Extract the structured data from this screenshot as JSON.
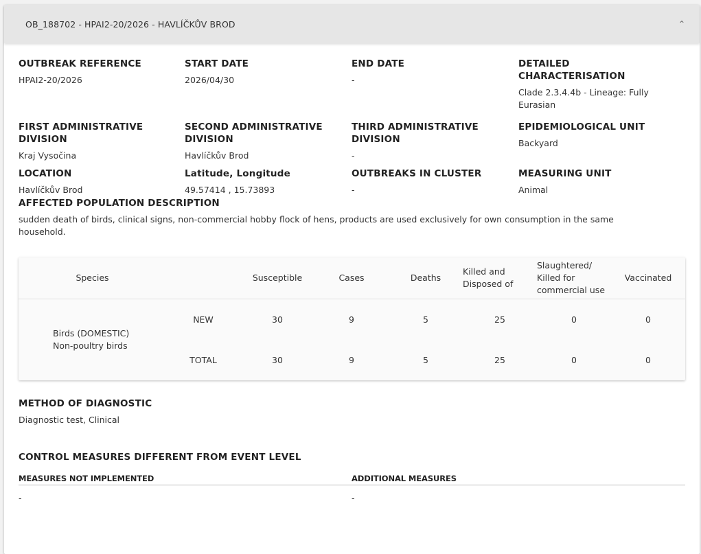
{
  "header": {
    "title": "OB_188702 - HPAI2-20/2026 - HAVLÍČKŮV BROD",
    "collapse_icon": "chevron-up-icon"
  },
  "fields": {
    "outbreak_reference": {
      "label": "OUTBREAK REFERENCE",
      "value": "HPAI2-20/2026"
    },
    "start_date": {
      "label": "START DATE",
      "value": "2026/04/30"
    },
    "end_date": {
      "label": "END DATE",
      "value": "-"
    },
    "detailed_characterisation": {
      "label": "DETAILED CHARACTERISATION",
      "value": "Clade 2.3.4.4b - Lineage: Fully Eurasian"
    },
    "first_admin": {
      "label": "FIRST ADMINISTRATIVE DIVISION",
      "value": "Kraj Vysočina"
    },
    "second_admin": {
      "label": "SECOND ADMINISTRATIVE DIVISION",
      "value": "Havlíčkův Brod"
    },
    "third_admin": {
      "label": "THIRD ADMINISTRATIVE DIVISION",
      "value": "-"
    },
    "epi_unit": {
      "label": "EPIDEMIOLOGICAL UNIT",
      "value": "Backyard"
    },
    "location": {
      "label": "LOCATION",
      "value": "Havlíčkův Brod"
    },
    "lat_long": {
      "label": "Latitude, Longitude",
      "value": "49.57414 , 15.73893"
    },
    "outbreaks_in_cluster": {
      "label": "OUTBREAKS IN CLUSTER",
      "value": "-"
    },
    "measuring_unit": {
      "label": "MEASURING UNIT",
      "value": "Animal"
    },
    "affected_population": {
      "label": "AFFECTED POPULATION DESCRIPTION",
      "value": "sudden death of birds, clinical signs, non-commercial hobby flock of hens, products are used exclusively for own consumption in the same household."
    }
  },
  "table": {
    "headers": {
      "species": "Species",
      "susceptible": "Susceptible",
      "cases": "Cases",
      "deaths": "Deaths",
      "killed": "Killed and Disposed of",
      "slaughtered": "Slaughtered/ Killed for commercial use",
      "vaccinated": "Vaccinated"
    },
    "species_line1": "Birds (DOMESTIC)",
    "species_line2": "Non-poultry birds",
    "rows": [
      {
        "type": "NEW",
        "susceptible": "30",
        "cases": "9",
        "deaths": "5",
        "killed": "25",
        "slaughtered": "0",
        "vaccinated": "0"
      },
      {
        "type": "TOTAL",
        "susceptible": "30",
        "cases": "9",
        "deaths": "5",
        "killed": "25",
        "slaughtered": "0",
        "vaccinated": "0"
      }
    ]
  },
  "diagnostic": {
    "label": "METHOD OF DIAGNOSTIC",
    "value": "Diagnostic test, Clinical"
  },
  "control_measures": {
    "title": "CONTROL MEASURES DIFFERENT FROM EVENT LEVEL",
    "not_implemented_label": "MEASURES NOT IMPLEMENTED",
    "additional_label": "ADDITIONAL MEASURES",
    "not_implemented_value": "-",
    "additional_value": "-"
  }
}
